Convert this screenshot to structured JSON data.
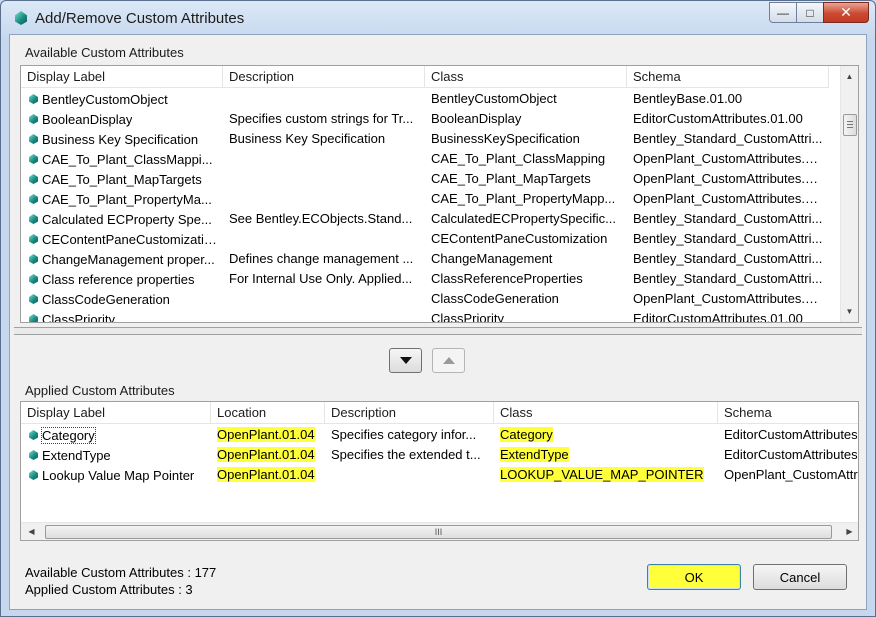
{
  "window": {
    "title": "Add/Remove Custom Attributes"
  },
  "available": {
    "group_label": "Available Custom Attributes",
    "columns": [
      "Display Label",
      "Description",
      "Class",
      "Schema"
    ],
    "rows": [
      {
        "label": "BentleyCustomObject",
        "description": "",
        "class": "BentleyCustomObject",
        "schema": "BentleyBase.01.00"
      },
      {
        "label": "BooleanDisplay",
        "description": "Specifies custom strings for Tr...",
        "class": "BooleanDisplay",
        "schema": "EditorCustomAttributes.01.00"
      },
      {
        "label": "Business Key Specification",
        "description": "Business Key Specification",
        "class": "BusinessKeySpecification",
        "schema": "Bentley_Standard_CustomAttri..."
      },
      {
        "label": "CAE_To_Plant_ClassMappi...",
        "description": "",
        "class": "CAE_To_Plant_ClassMapping",
        "schema": "OpenPlant_CustomAttributes.0..."
      },
      {
        "label": "CAE_To_Plant_MapTargets",
        "description": "",
        "class": "CAE_To_Plant_MapTargets",
        "schema": "OpenPlant_CustomAttributes.0..."
      },
      {
        "label": "CAE_To_Plant_PropertyMa...",
        "description": "",
        "class": "CAE_To_Plant_PropertyMapp...",
        "schema": "OpenPlant_CustomAttributes.0..."
      },
      {
        "label": "Calculated ECProperty Spe...",
        "description": "See Bentley.ECObjects.Stand...",
        "class": "CalculatedECPropertySpecific...",
        "schema": "Bentley_Standard_CustomAttri..."
      },
      {
        "label": "CEContentPaneCustomization",
        "description": "",
        "class": "CEContentPaneCustomization",
        "schema": "Bentley_Standard_CustomAttri..."
      },
      {
        "label": "ChangeManagement proper...",
        "description": "Defines change management ...",
        "class": "ChangeManagement",
        "schema": "Bentley_Standard_CustomAttri..."
      },
      {
        "label": "Class reference properties",
        "description": "For Internal Use Only.  Applied...",
        "class": "ClassReferenceProperties",
        "schema": "Bentley_Standard_CustomAttri..."
      },
      {
        "label": "ClassCodeGeneration",
        "description": "",
        "class": "ClassCodeGeneration",
        "schema": "OpenPlant_CustomAttributes.0..."
      },
      {
        "label": "ClassPriority",
        "description": "",
        "class": "ClassPriority",
        "schema": "EditorCustomAttributes.01.00"
      }
    ]
  },
  "applied": {
    "group_label": "Applied Custom Attributes",
    "columns": [
      "Display Label",
      "Location",
      "Description",
      "Class",
      "Schema"
    ],
    "rows": [
      {
        "label": "Category",
        "location": "OpenPlant.01.04",
        "description": "Specifies category infor...",
        "class": "Category",
        "schema": "EditorCustomAttributes"
      },
      {
        "label": "ExtendType",
        "location": "OpenPlant.01.04",
        "description": "Specifies the extended t...",
        "class": "ExtendType",
        "schema": "EditorCustomAttributes"
      },
      {
        "label": "Lookup Value Map Pointer",
        "location": "OpenPlant.01.04",
        "description": "",
        "class": "LOOKUP_VALUE_MAP_POINTER",
        "schema": "OpenPlant_CustomAttri"
      }
    ],
    "scroll_thumb_glyph": "III"
  },
  "status": {
    "available_count": "Available Custom Attributes : 177",
    "applied_count": "Applied Custom Attributes : 3"
  },
  "buttons": {
    "ok": "OK",
    "cancel": "Cancel",
    "move_down_icon": "triangle-down-icon",
    "move_up_icon": "triangle-up-icon"
  },
  "colors": {
    "highlight": "#ffff3a",
    "title_bar": "#c9d9ee",
    "close_button": "#c23a25"
  }
}
